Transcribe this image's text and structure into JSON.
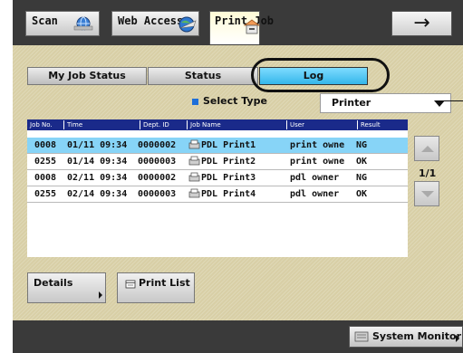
{
  "header": {
    "tabs": [
      {
        "label": "Scan",
        "icon": "scan-globe-icon"
      },
      {
        "label": "Web Access",
        "icon": "globe-icon"
      },
      {
        "label": "Print Job",
        "icon": "printer-tray-icon",
        "active": true
      }
    ],
    "next_icon": "→"
  },
  "subtabs": [
    {
      "label": "My Job Status"
    },
    {
      "label": "Status"
    },
    {
      "label": "Log",
      "active": true
    }
  ],
  "filter": {
    "label": "Select Type",
    "value": "Printer"
  },
  "table": {
    "columns": [
      "Job No.",
      "Time",
      "Dept. ID",
      "Job Name",
      "User",
      "Result"
    ],
    "rows": [
      {
        "job_no": "0008",
        "time": "01/11 09:34",
        "dept_id": "0000002",
        "job_name": "PDL Print1",
        "user": "print owne",
        "result": "NG",
        "selected": true
      },
      {
        "job_no": "0255",
        "time": "01/14 09:34",
        "dept_id": "0000003",
        "job_name": "PDL Print2",
        "user": "print owne",
        "result": "OK"
      },
      {
        "job_no": "0008",
        "time": "02/11 09:34",
        "dept_id": "0000002",
        "job_name": "PDL Print3",
        "user": "pdl owner",
        "result": "NG"
      },
      {
        "job_no": "0255",
        "time": "02/14 09:34",
        "dept_id": "0000003",
        "job_name": "PDL Print4",
        "user": "pdl owner",
        "result": "OK"
      }
    ]
  },
  "pagination": {
    "indicator": "1/1"
  },
  "actions": {
    "details_label": "Details",
    "print_list_label": "Print List"
  },
  "footer": {
    "system_monitor_label": "System Monitor"
  },
  "colors": {
    "panel": "#d8cfa6",
    "selected_row": "#87d4f7",
    "active_tab": "#34b6ea",
    "table_header": "#1a2a8a",
    "bar": "#3a3a3a"
  }
}
